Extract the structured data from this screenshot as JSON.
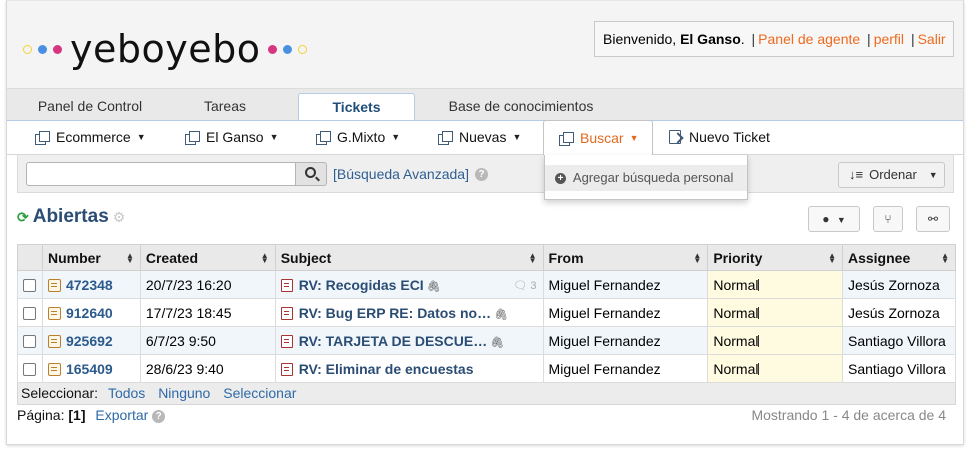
{
  "header": {
    "logo_text": "yeboyebo",
    "welcome_prefix": "Bienvenido,",
    "user_name": "El Ganso",
    "welcome_suffix": ".",
    "links": [
      "Panel de agente",
      "perfil",
      "Salir"
    ],
    "logo_dots_left": [
      "#f3d236",
      "#4a90e2",
      "#d6357f"
    ],
    "logo_dots_right": [
      "#d6357f",
      "#4a90e2",
      "#f3d236"
    ]
  },
  "tabs": [
    {
      "label": "Panel de Control",
      "active": false
    },
    {
      "label": "Tareas",
      "active": false
    },
    {
      "label": "Tickets",
      "active": true
    },
    {
      "label": "Base de conocimientos",
      "active": false
    }
  ],
  "subnav": {
    "ecommerce": "Ecommerce",
    "elganso": "El Ganso",
    "gmixto": "G.Mixto",
    "nuevas": "Nuevas",
    "buscar": "Buscar",
    "nuevo_ticket": "Nuevo Ticket"
  },
  "search": {
    "placeholder": "",
    "value": "",
    "advanced": "[Búsqueda Avanzada]",
    "order": "Ordenar"
  },
  "dropdown": {
    "add_search": "Agregar búsqueda personal"
  },
  "queue": {
    "title": "Abiertas"
  },
  "table": {
    "headers": [
      "Number",
      "Created",
      "Subject",
      "From",
      "Priority",
      "Assignee"
    ],
    "rows": [
      {
        "number": "472348",
        "created": "20/7/23 16:20",
        "subject": "RV: Recogidas ECI",
        "attach": true,
        "thread": "3",
        "from": "Miguel Fernandez",
        "priority": "Normal",
        "assignee": "Jesús Zornoza"
      },
      {
        "number": "912640",
        "created": "17/7/23 18:45",
        "subject": "RV: Bug ERP RE: Datos no…",
        "attach": true,
        "thread": "",
        "from": "Miguel Fernandez",
        "priority": "Normal",
        "assignee": "Jesús Zornoza"
      },
      {
        "number": "925692",
        "created": "6/7/23 9:50",
        "subject": "RV: TARJETA DE DESCUE…",
        "attach": true,
        "thread": "",
        "from": "Miguel Fernandez",
        "priority": "Normal",
        "assignee": "Santiago Villora"
      },
      {
        "number": "165409",
        "created": "28/6/23 9:40",
        "subject": "RV: Eliminar de encuestas",
        "attach": false,
        "thread": "",
        "from": "Miguel Fernandez",
        "priority": "Normal",
        "assignee": "Santiago Villora"
      }
    ]
  },
  "selector": {
    "label": "Seleccionar:",
    "all": "Todos",
    "none": "Ninguno",
    "select": "Seleccionar"
  },
  "pager": {
    "label": "Página:",
    "current": "[1]",
    "export": "Exportar",
    "showing": "Mostrando 1 - 4 de acerca de 4"
  }
}
